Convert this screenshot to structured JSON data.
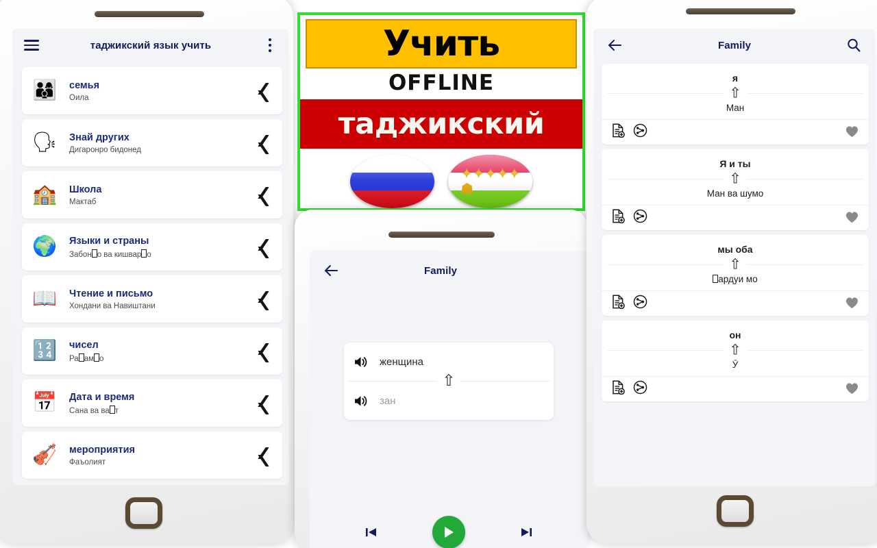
{
  "left_phone": {
    "appbar": {
      "menu_icon": "hamburger-icon",
      "title": "таджикский язык учить",
      "overflow_icon": "kebab-menu-icon"
    },
    "categories": [
      {
        "emoji": "👨‍👩‍👦",
        "title": "семья",
        "subtitle": "Оила"
      },
      {
        "emoji": "🗣",
        "title": "Знай других",
        "subtitle": "Дигаронро бидонед"
      },
      {
        "emoji": "🏫",
        "title": "Школа",
        "subtitle": "Мактаб"
      },
      {
        "emoji": "🌍",
        "title": "Языки и страны",
        "subtitle": "Забон□о ва кишвар□о"
      },
      {
        "emoji": "📖",
        "title": "Чтение и письмо",
        "subtitle": "Хондани ва Навиштани"
      },
      {
        "emoji": "🔢",
        "title": "чисел",
        "subtitle": "Ра□ам□о"
      },
      {
        "emoji": "📅",
        "title": "Дата и время",
        "subtitle": "Сана ва ва□т"
      },
      {
        "emoji": "🎻",
        "title": "мероприятия",
        "subtitle": "Фаъолият"
      }
    ],
    "chevron_icon": "chevron-right-icon"
  },
  "banner": {
    "line1": "Учить",
    "line2": "OFFLINE",
    "line3": "таджикский",
    "flag_left": "russia-flag",
    "flag_right": "tajikistan-flag",
    "border_color": "#2ee02e",
    "yellow_color": "#ffc000",
    "red_color": "#cc0000"
  },
  "center_phone": {
    "appbar": {
      "back_icon": "arrow-left-icon",
      "title": "Family"
    },
    "card": {
      "source_speaker_icon": "speaker-icon",
      "source_word": "женщина",
      "arrow_mark": "⇧",
      "target_speaker_icon": "speaker-icon",
      "target_word": "зан"
    },
    "controls": {
      "previous_icon": "skip-previous-icon",
      "play_icon": "play-icon",
      "next_icon": "skip-next-icon",
      "play_color": "#23a93a"
    }
  },
  "right_phone": {
    "appbar": {
      "back_icon": "arrow-left-icon",
      "title": "Family",
      "search_icon": "search-icon"
    },
    "action_icons": {
      "add_note_icon": "document-add-icon",
      "share_icon": "share-circle-icon",
      "favorite_icon": "heart-filled-icon",
      "favorite_color": "#8a8a8a"
    },
    "arrow_mark": "⇧",
    "phrases": [
      {
        "source": "я",
        "target": "Ман"
      },
      {
        "source": "Я и ты",
        "target": "Ман ва шумо"
      },
      {
        "source": "мы оба",
        "target": "□ардуи мо"
      },
      {
        "source": "он",
        "target": "Ӯ"
      }
    ]
  }
}
